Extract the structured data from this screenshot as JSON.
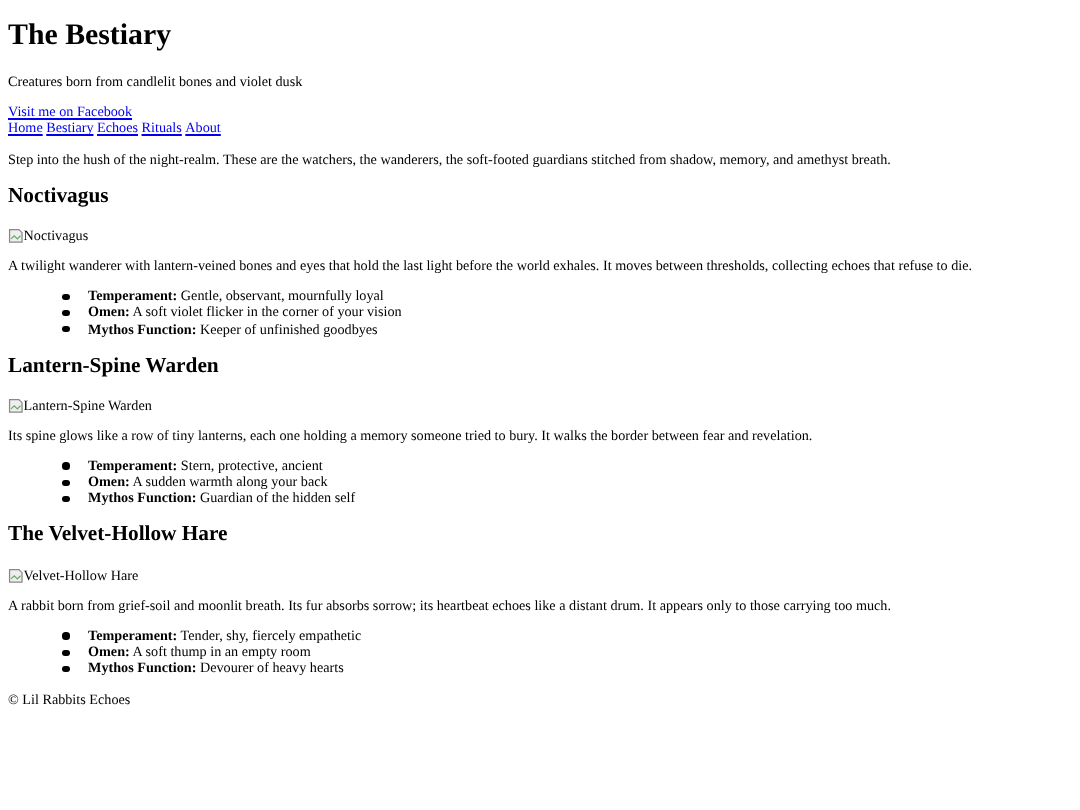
{
  "title": "The Bestiary",
  "tagline": "Creatures born from candlelit bones and violet dusk",
  "facebook_link": "Visit me on Facebook",
  "nav": [
    "Home",
    "Bestiary",
    "Echoes",
    "Rituals",
    "About"
  ],
  "intro": "Step into the hush of the night-realm. These are the watchers, the wanderers, the soft-footed guardians stitched from shadow, memory, and amethyst breath.",
  "creatures": [
    {
      "name": "Noctivagus",
      "image_alt": "Noctivagus",
      "description": "A twilight wanderer with lantern-veined bones and eyes that hold the last light before the world exhales. It moves between thresholds, collecting echoes that refuse to die.",
      "traits": [
        "**Temperament:** Gentle, observant, mournfully loyal",
        "**Omen:** A soft violet flicker in the corner of your vision",
        "**Mythos Function:** Keeper of unfinished goodbyes"
      ]
    },
    {
      "name": "Lantern-Spine Warden",
      "image_alt": "Lantern-Spine Warden",
      "description": "Its spine glows like a row of tiny lanterns, each one holding a memory someone tried to bury. It walks the border between fear and revelation.",
      "traits": [
        "**Temperament:** Stern, protective, ancient",
        "**Omen:** A sudden warmth along your back",
        "**Mythos Function:** Guardian of the hidden self"
      ]
    },
    {
      "name": "The Velvet-Hollow Hare",
      "image_alt": "Velvet-Hollow Hare",
      "description": "A rabbit born from grief-soil and moonlit breath. Its fur absorbs sorrow; its heartbeat echoes like a distant drum. It appears only to those carrying too much.",
      "traits": [
        "**Temperament:** Tender, shy, fiercely empathetic",
        "**Omen:** A soft thump in an empty room",
        "**Mythos Function:** Devourer of heavy hearts"
      ]
    }
  ],
  "footer": "© Lil Rabbits Echoes"
}
